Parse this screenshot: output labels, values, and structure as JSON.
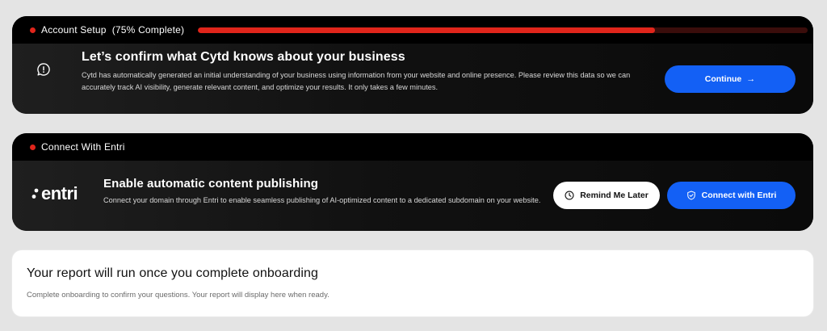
{
  "setup": {
    "header": "Account Setup  (75% Complete)",
    "progress_percent": 75,
    "title": "Let’s confirm what Cytd knows about your business",
    "description": "Cytd has automatically generated an initial understanding of your business using information from your website and online presence. Please review this data so we can accurately track AI visibility, generate relevant content, and optimize your results. It only takes a few minutes.",
    "continue_label": "Continue",
    "icon": "alert-chat-icon"
  },
  "entri": {
    "header": "Connect With Entri",
    "logo_text": "entri",
    "title": "Enable automatic content publishing",
    "description": "Connect your domain through Entri to enable seamless publishing of AI-optimized content to a dedicated subdomain on your website.",
    "remind_label": "Remind Me Later",
    "connect_label": "Connect with Entri"
  },
  "report": {
    "title": "Your report will run once you complete onboarding",
    "description": "Complete onboarding to confirm your questions. Your report will display here when ready."
  },
  "colors": {
    "accent_red": "#e0251b",
    "primary_blue": "#1360f5"
  }
}
